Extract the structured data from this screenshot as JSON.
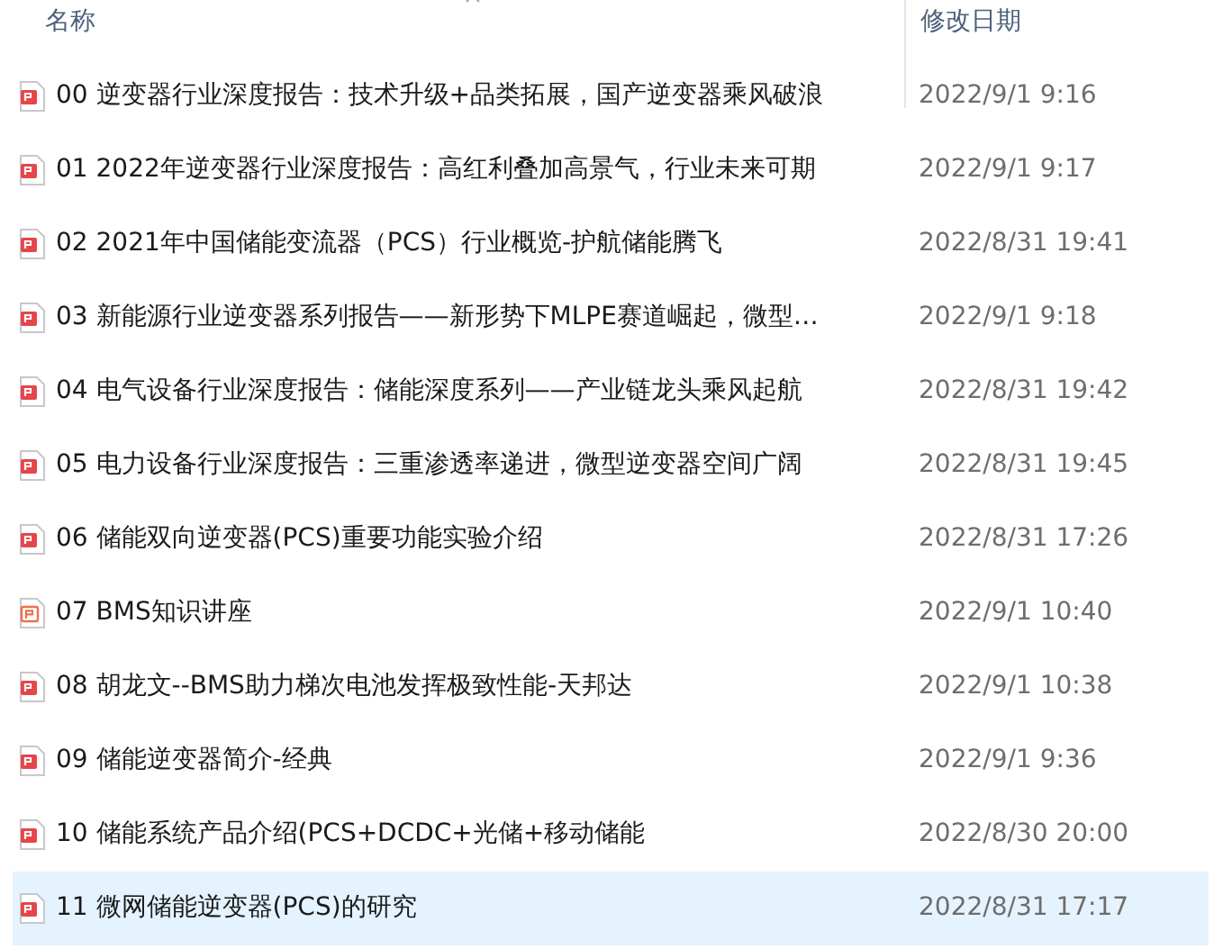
{
  "columns": [
    {
      "label": "名称",
      "sorted": true
    },
    {
      "label": "修改日期",
      "sorted": false
    }
  ],
  "files": [
    {
      "name": "00 逆变器行业深度报告：技术升级+品类拓展，国产逆变器乘风破浪",
      "modified": "2022/9/1 9:16",
      "kind": "pdf",
      "selected": false
    },
    {
      "name": "01 2022年逆变器行业深度报告：高红利叠加高景气，行业未来可期",
      "modified": "2022/9/1 9:17",
      "kind": "pdf",
      "selected": false
    },
    {
      "name": "02 2021年中国储能变流器（PCS）行业概览-护航储能腾飞",
      "modified": "2022/8/31 19:41",
      "kind": "pdf",
      "selected": false
    },
    {
      "name": "03 新能源行业逆变器系列报告——新形势下MLPE赛道崛起，微型…",
      "modified": "2022/9/1 9:18",
      "kind": "pdf",
      "selected": false
    },
    {
      "name": "04 电气设备行业深度报告：储能深度系列——产业链龙头乘风起航",
      "modified": "2022/8/31 19:42",
      "kind": "pdf",
      "selected": false
    },
    {
      "name": "05 电力设备行业深度报告：三重渗透率递进，微型逆变器空间广阔",
      "modified": "2022/8/31 19:45",
      "kind": "pdf",
      "selected": false
    },
    {
      "name": "06 储能双向逆变器(PCS)重要功能实验介绍",
      "modified": "2022/8/31 17:26",
      "kind": "pdf",
      "selected": false
    },
    {
      "name": "07 BMS知识讲座",
      "modified": "2022/9/1 10:40",
      "kind": "ppt",
      "selected": false
    },
    {
      "name": "08 胡龙文--BMS助力梯次电池发挥极致性能-天邦达",
      "modified": "2022/9/1 10:38",
      "kind": "pdf",
      "selected": false
    },
    {
      "name": "09 储能逆变器简介-经典",
      "modified": "2022/9/1 9:36",
      "kind": "pdf",
      "selected": false
    },
    {
      "name": "10 储能系统产品介绍(PCS+DCDC+光储+移动储能",
      "modified": "2022/8/30 20:00",
      "kind": "pdf",
      "selected": false
    },
    {
      "name": "11 微网储能逆变器(PCS)的研究",
      "modified": "2022/8/31 17:17",
      "kind": "pdf",
      "selected": true
    }
  ]
}
